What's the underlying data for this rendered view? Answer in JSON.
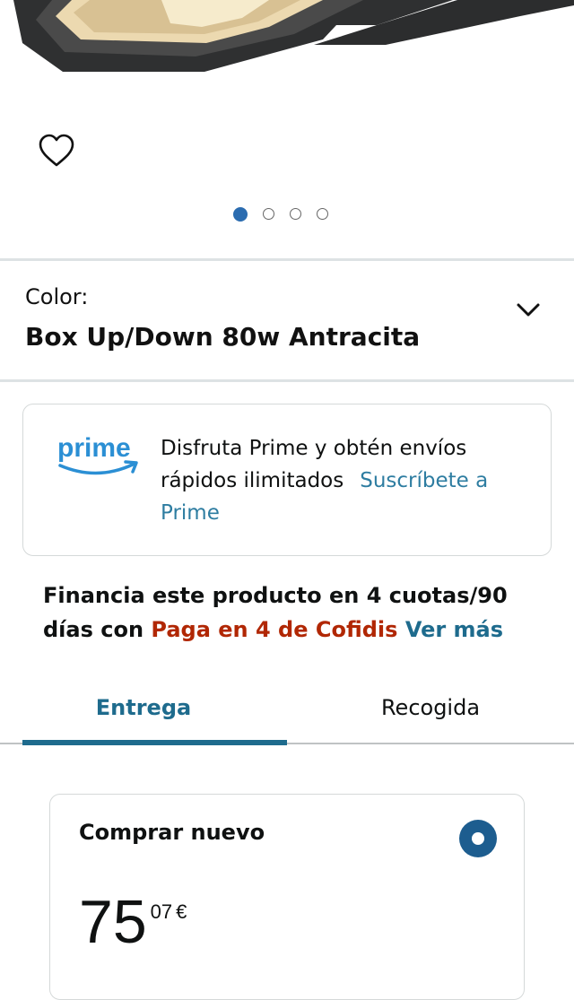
{
  "gallery": {
    "image_count": 4,
    "active_index": 0
  },
  "variant": {
    "label": "Color:",
    "value": "Box Up/Down 80w Antracita"
  },
  "prime": {
    "logo_text": "prime",
    "message": "Disfruta Prime y obtén envíos rápidos ilimitados",
    "link_part1": "Suscríbete a",
    "link_part2": "Prime"
  },
  "financing": {
    "text_line": "Financia este producto en 4 cuotas/90 días con",
    "provider": "Paga en 4 de Cofidis",
    "link": "Ver más"
  },
  "tabs": [
    {
      "label": "Entrega",
      "active": true
    },
    {
      "label": "Recogida",
      "active": false
    }
  ],
  "buy_box": {
    "title": "Comprar nuevo",
    "price_whole": "75",
    "price_fraction": "07",
    "currency": "€",
    "selected": true
  },
  "colors": {
    "link": "#1e6b8d",
    "price_red": "#b12704",
    "radio": "#1d5d8f",
    "dot_active": "#2b6cb0"
  }
}
